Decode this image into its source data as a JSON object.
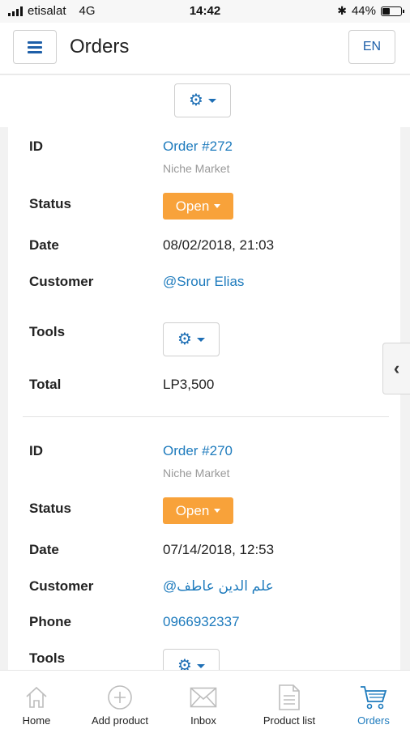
{
  "status_bar": {
    "carrier": "etisalat",
    "network": "4G",
    "time": "14:42",
    "bluetooth": "✱",
    "battery": "44%",
    "battery_level": 0.44
  },
  "header": {
    "title": "Orders",
    "lang": "EN"
  },
  "orders": [
    {
      "id_label": "ID",
      "id_value": "Order #272",
      "store": "Niche Market",
      "status_label": "Status",
      "status": "Open",
      "date_label": "Date",
      "date": "08/02/2018, 21:03",
      "customer_label": "Customer",
      "customer": "@Srour Elias",
      "tools_label": "Tools",
      "total_label": "Total",
      "total": "LP3,500"
    },
    {
      "id_label": "ID",
      "id_value": "Order #270",
      "store": "Niche Market",
      "status_label": "Status",
      "status": "Open",
      "date_label": "Date",
      "date": "07/14/2018, 12:53",
      "customer_label": "Customer",
      "customer": "@علم الدين عاطف",
      "phone_label": "Phone",
      "phone": "0966932337",
      "tools_label": "Tools"
    }
  ],
  "bottom_nav": [
    {
      "label": "Home",
      "icon": "home-icon"
    },
    {
      "label": "Add product",
      "icon": "add-circle-icon"
    },
    {
      "label": "Inbox",
      "icon": "envelope-icon"
    },
    {
      "label": "Product list",
      "icon": "document-icon"
    },
    {
      "label": "Orders",
      "icon": "cart-icon",
      "active": true
    }
  ],
  "colors": {
    "accent": "#1e7bbd",
    "status_open": "#f8a23a"
  }
}
